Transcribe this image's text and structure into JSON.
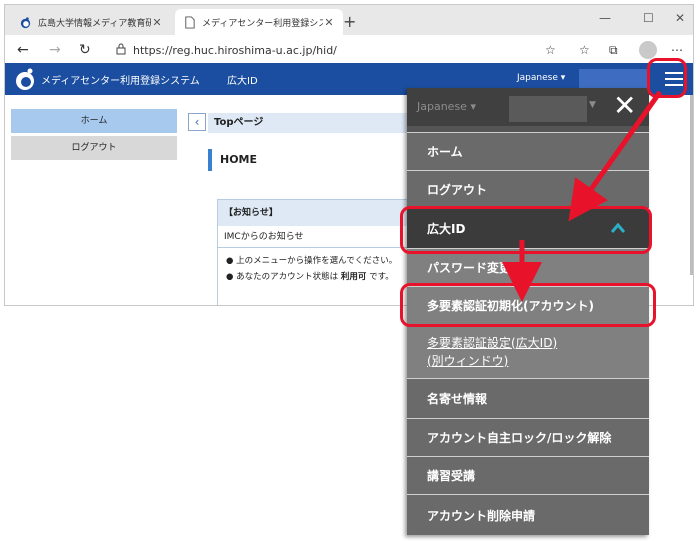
{
  "browser": {
    "tabs": [
      {
        "title": "広島大学情報メディア教育研究セン"
      },
      {
        "title": "メディアセンター利用登録システム"
      }
    ],
    "url": "https://reg.huc.hiroshima-u.ac.jp/hid/"
  },
  "site": {
    "title": "メディアセンター利用登録システム",
    "nav_hid": "広大ID",
    "language": "Japanese",
    "sidebar": [
      "ホーム",
      "ログアウト"
    ],
    "breadcrumb": "Topページ",
    "page_heading": "HOME",
    "notice": {
      "title": "【お知らせ】",
      "subtitle": "IMCからのお知らせ",
      "line1": "上のメニューから操作を選んでください。",
      "line2_prefix": "あなたのアカウント状態は",
      "line2_status": "利用可",
      "line2_suffix": "です。"
    }
  },
  "menu": {
    "language": "Japanese",
    "items": [
      {
        "label": "ホーム"
      },
      {
        "label": "ログアウト"
      },
      {
        "label": "広大ID"
      },
      {
        "label": "パスワード変更"
      },
      {
        "label": "多要素認証初期化(アカウント)"
      },
      {
        "label": "多要素認証設定(広大ID)",
        "label2": "(別ウィンドウ)"
      },
      {
        "label": "名寄せ情報"
      },
      {
        "label": "アカウント自主ロック/ロック解除"
      },
      {
        "label": "講習受講"
      },
      {
        "label": "アカウント削除申請"
      }
    ]
  },
  "colors": {
    "header": "#1b4ea0",
    "highlight": "#e8122a",
    "menu_panel": "#404040",
    "chevron": "#2bb0c8"
  }
}
